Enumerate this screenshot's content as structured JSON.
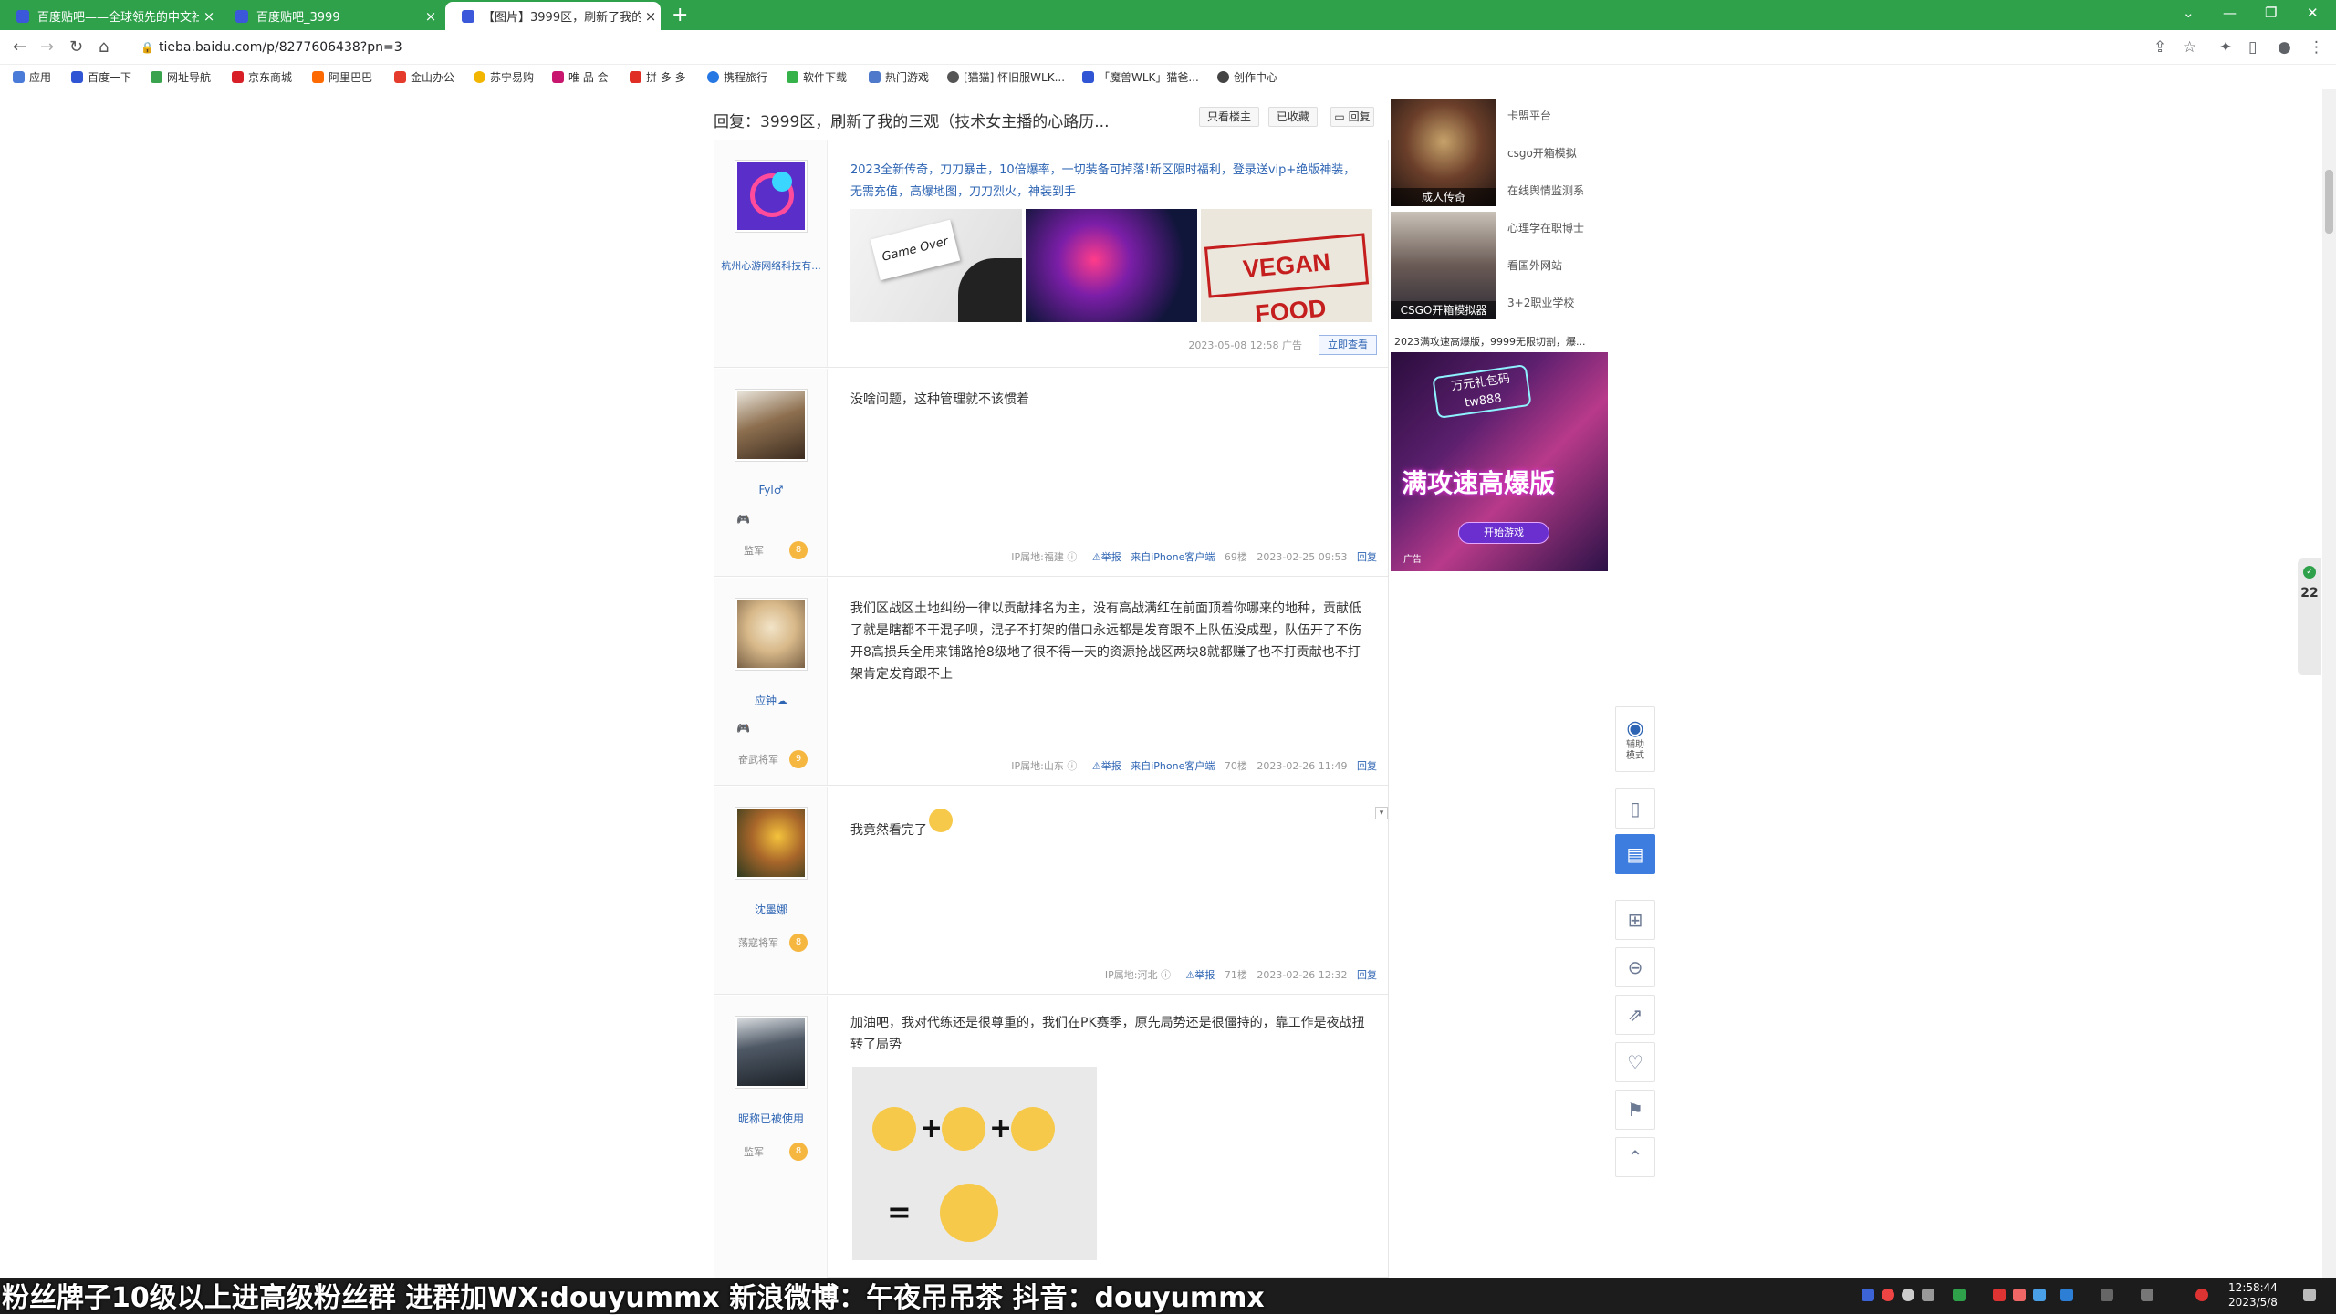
{
  "browser": {
    "tabs": [
      {
        "title": "百度贴吧——全球领先的中文社",
        "active": false
      },
      {
        "title": "百度贴吧_3999",
        "active": false
      },
      {
        "title": "【图片】3999区，刷新了我的三",
        "active": true
      }
    ],
    "address": "tieba.baidu.com/p/8277606438?pn=3",
    "bookmarks": [
      "应用",
      "百度一下",
      "网址导航",
      "京东商城",
      "阿里巴巴",
      "金山办公",
      "苏宁易购",
      "唯 品 会",
      "拼 多 多",
      "携程旅行",
      "软件下载",
      "热门游戏",
      "[猫猫] 怀旧服WLK...",
      "「魔兽WLK」猫爸...",
      "创作中心"
    ]
  },
  "thread": {
    "title": "回复：3999区，刷新了我的三观（技术女主播的心路历...",
    "buttons": {
      "only_op": "只看楼主",
      "favorited": "已收藏",
      "reply": "回复"
    }
  },
  "ad_post": {
    "advertiser": "杭州心游网络科技有...",
    "text": "2023全新传奇，刀刀暴击，10倍爆率，一切装备可掉落!新区限时福利，登录送vip+绝版神装，无需充值，高爆地图，刀刀烈火，神装到手",
    "images": [
      "Game Over",
      "",
      "VEGAN FOOD"
    ],
    "meta": "2023-05-08 12:58 广告",
    "cta": "立即查看"
  },
  "posts": [
    {
      "user": "Fyl♂",
      "level_title": "监军",
      "level": "8",
      "text": "没啥问题，这种管理就不该惯着",
      "ip": "IP属地:福建",
      "report": "举报",
      "client": "来自iPhone客户端",
      "floor": "69楼",
      "time": "2023-02-25 09:53",
      "reply": "回复"
    },
    {
      "user": "应钟☁",
      "level_title": "奋武将军",
      "level": "9",
      "text": "我们区战区土地纠纷一律以贡献排名为主，没有高战满红在前面顶着你哪来的地种，贡献低了就是瞎都不干混子呗，混子不打架的借口永远都是发育跟不上队伍没成型，队伍开了不伤开8高损兵全用来铺路抢8级地了很不得一天的资源抢战区两块8就都赚了也不打贡献也不打架肯定发育跟不上",
      "ip": "IP属地:山东",
      "report": "举报",
      "client": "来自iPhone客户端",
      "floor": "70楼",
      "time": "2023-02-26 11:49",
      "reply": "回复"
    },
    {
      "user": "沈墨娜",
      "level_title": "荡寇将军",
      "level": "8",
      "text": "我竟然看完了",
      "ip": "IP属地:河北",
      "report": "举报",
      "client": "",
      "floor": "71楼",
      "time": "2023-02-26 12:32",
      "reply": "回复"
    },
    {
      "user": "昵称已被使用",
      "level_title": "监军",
      "level": "8",
      "text": "加油吧，我对代练还是很尊重的，我们在PK赛季，原先局势还是很僵持的，靠工作是夜战扭转了局势",
      "ip": "",
      "report": "",
      "client": "",
      "floor": "",
      "time": "",
      "reply": ""
    }
  ],
  "right_ads": {
    "thumbs": [
      {
        "label": "成人传奇"
      },
      {
        "label": "CSGO开箱模拟器"
      }
    ],
    "links": [
      "卡盟平台",
      "csgo开箱模拟",
      "在线舆情监测系",
      "心理学在职博士",
      "看国外网站",
      "3+2职业学校"
    ],
    "caption": "2023满攻速高爆版，9999无限切割，爆...",
    "banner_text": "满攻速高爆版",
    "banner_code": "万元礼包码 tw888",
    "banner_button": "开始游戏",
    "banner_tag": "广告"
  },
  "float_tools": {
    "assist_label": "辅助\n模式"
  },
  "widget": {
    "value": "22"
  },
  "taskbar": {
    "subtitle": "粉丝牌子10级以上进高级粉丝群  进群加WX:douyummx 新浪微博：午夜吊吊茶    抖音：douyummx",
    "time": "12:58:44",
    "date": "2023/5/8"
  }
}
